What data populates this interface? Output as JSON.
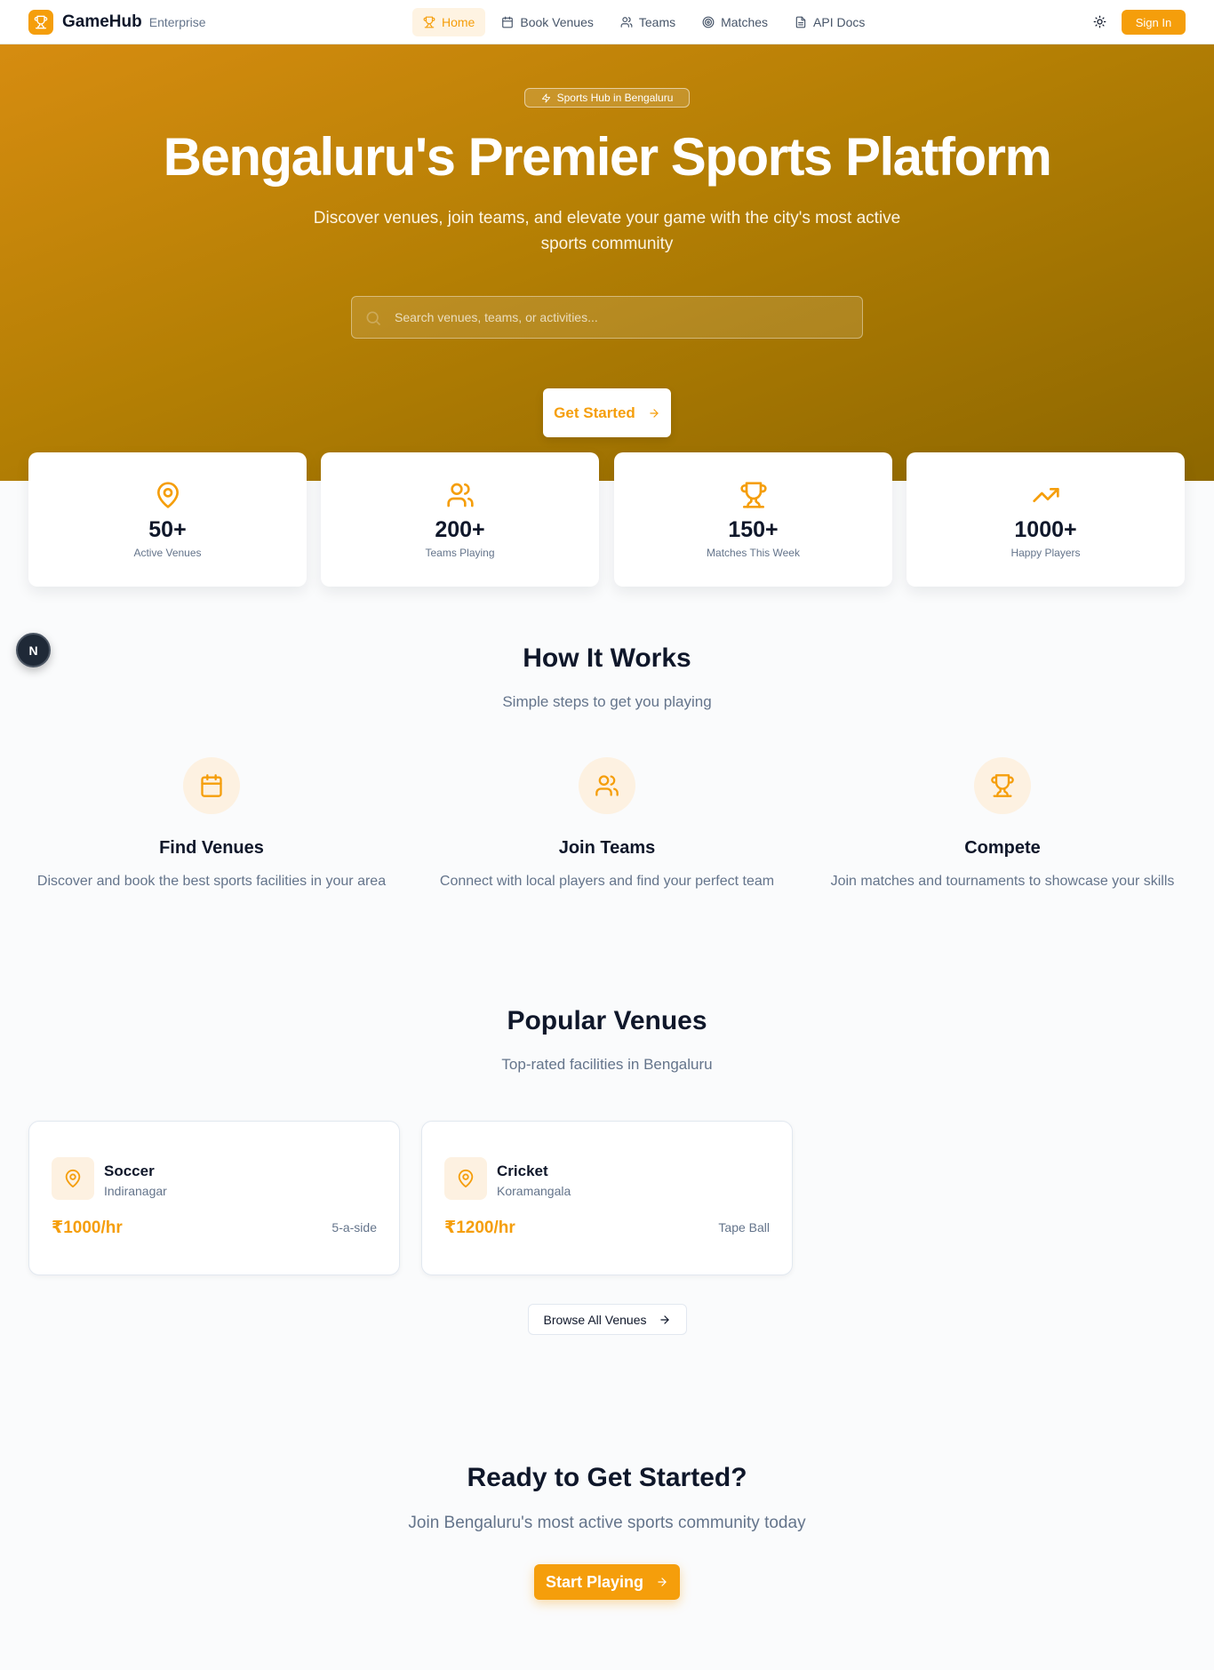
{
  "nav": {
    "brand_name": "GameHub",
    "brand_sub": "Enterprise",
    "links": [
      {
        "label": "Home",
        "icon": "trophy-icon",
        "active": true
      },
      {
        "label": "Book Venues",
        "icon": "calendar-icon"
      },
      {
        "label": "Teams",
        "icon": "users-icon"
      },
      {
        "label": "Matches",
        "icon": "target-icon"
      },
      {
        "label": "API Docs",
        "icon": "document-icon"
      }
    ],
    "signin_label": "Sign In"
  },
  "hero": {
    "badge": "Sports Hub in Bengaluru",
    "title": "Bengaluru's Premier Sports Platform",
    "subtitle": "Discover venues, join teams, and elevate your game with the city's most active sports community",
    "search_placeholder": "Search venues, teams, or activities...",
    "search_value": "",
    "cta_label": "Get Started"
  },
  "stats": [
    {
      "value": "50+",
      "label": "Active Venues",
      "icon": "map-pin-icon"
    },
    {
      "value": "200+",
      "label": "Teams Playing",
      "icon": "users-icon"
    },
    {
      "value": "150+",
      "label": "Matches This Week",
      "icon": "trophy-icon"
    },
    {
      "value": "1000+",
      "label": "Happy Players",
      "icon": "trending-up-icon"
    }
  ],
  "dev_badge": "N",
  "how": {
    "title": "How It Works",
    "subtitle": "Simple steps to get you playing",
    "steps": [
      {
        "title": "Find Venues",
        "desc": "Discover and book the best sports facilities in your area",
        "icon": "calendar-icon"
      },
      {
        "title": "Join Teams",
        "desc": "Connect with local players and find your perfect team",
        "icon": "users-icon"
      },
      {
        "title": "Compete",
        "desc": "Join matches and tournaments to showcase your skills",
        "icon": "trophy-icon"
      }
    ]
  },
  "venues": {
    "title": "Popular Venues",
    "subtitle": "Top-rated facilities in Bengaluru",
    "items": [
      {
        "name": "Soccer",
        "location": "Indiranagar",
        "price": "₹1000/hr",
        "type": "5-a-side"
      },
      {
        "name": "Cricket",
        "location": "Koramangala",
        "price": "₹1200/hr",
        "type": "Tape Ball"
      }
    ],
    "browse_label": "Browse All Venues"
  },
  "ready": {
    "title": "Ready to Get Started?",
    "subtitle": "Join Bengaluru's most active sports community today",
    "button_label": "Start Playing"
  },
  "colors": {
    "accent": "#f59e0b",
    "hero_start": "#d68c10",
    "hero_end": "#8d6700"
  }
}
